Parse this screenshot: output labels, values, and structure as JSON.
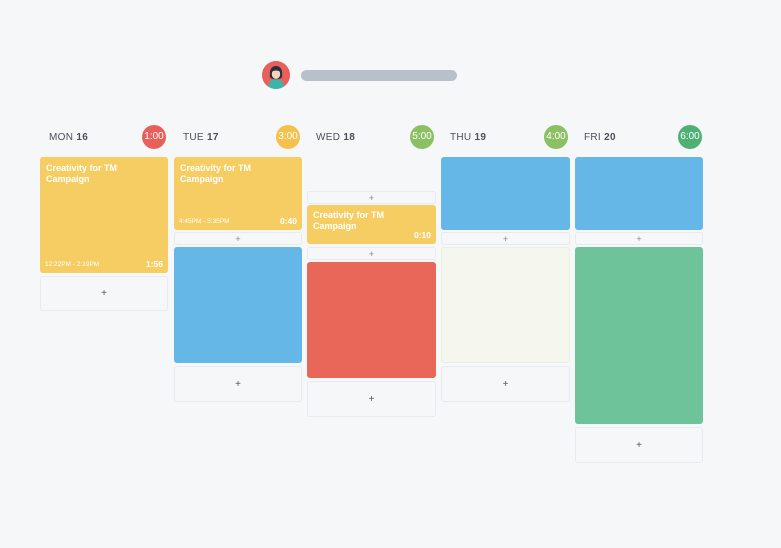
{
  "colors": {
    "yellow": "#f5cd62",
    "blue": "#65b7e8",
    "red": "#e96758",
    "green": "#6fc39a",
    "cream": "#f5f7ee",
    "badge_red": "#e8605a",
    "badge_yellow": "#f4c14f",
    "badge_lightgreen": "#8cc063",
    "badge_darkgreen": "#4fb074"
  },
  "header": {
    "avatar_icon": "user-avatar-icon"
  },
  "days": [
    {
      "name": "MON",
      "date": "16",
      "total": "1:00"
    },
    {
      "name": "TUE",
      "date": "17",
      "total": "3:00"
    },
    {
      "name": "WED",
      "date": "18",
      "total": "5:00"
    },
    {
      "name": "THU",
      "date": "19",
      "total": "4:00"
    },
    {
      "name": "FRI",
      "date": "20",
      "total": "6:00"
    }
  ],
  "events": {
    "mon": {
      "title": "Creativity for TM Campaign",
      "time": "12:22PM - 2:19PM",
      "duration": "1:56"
    },
    "tue": {
      "title": "Creativity for TM Campaign",
      "time": "4:45PM - 5:35PM",
      "duration": "0:40"
    },
    "wed": {
      "title": "Creativity for TM Campaign",
      "duration": "0:10"
    }
  },
  "add_label": "+"
}
